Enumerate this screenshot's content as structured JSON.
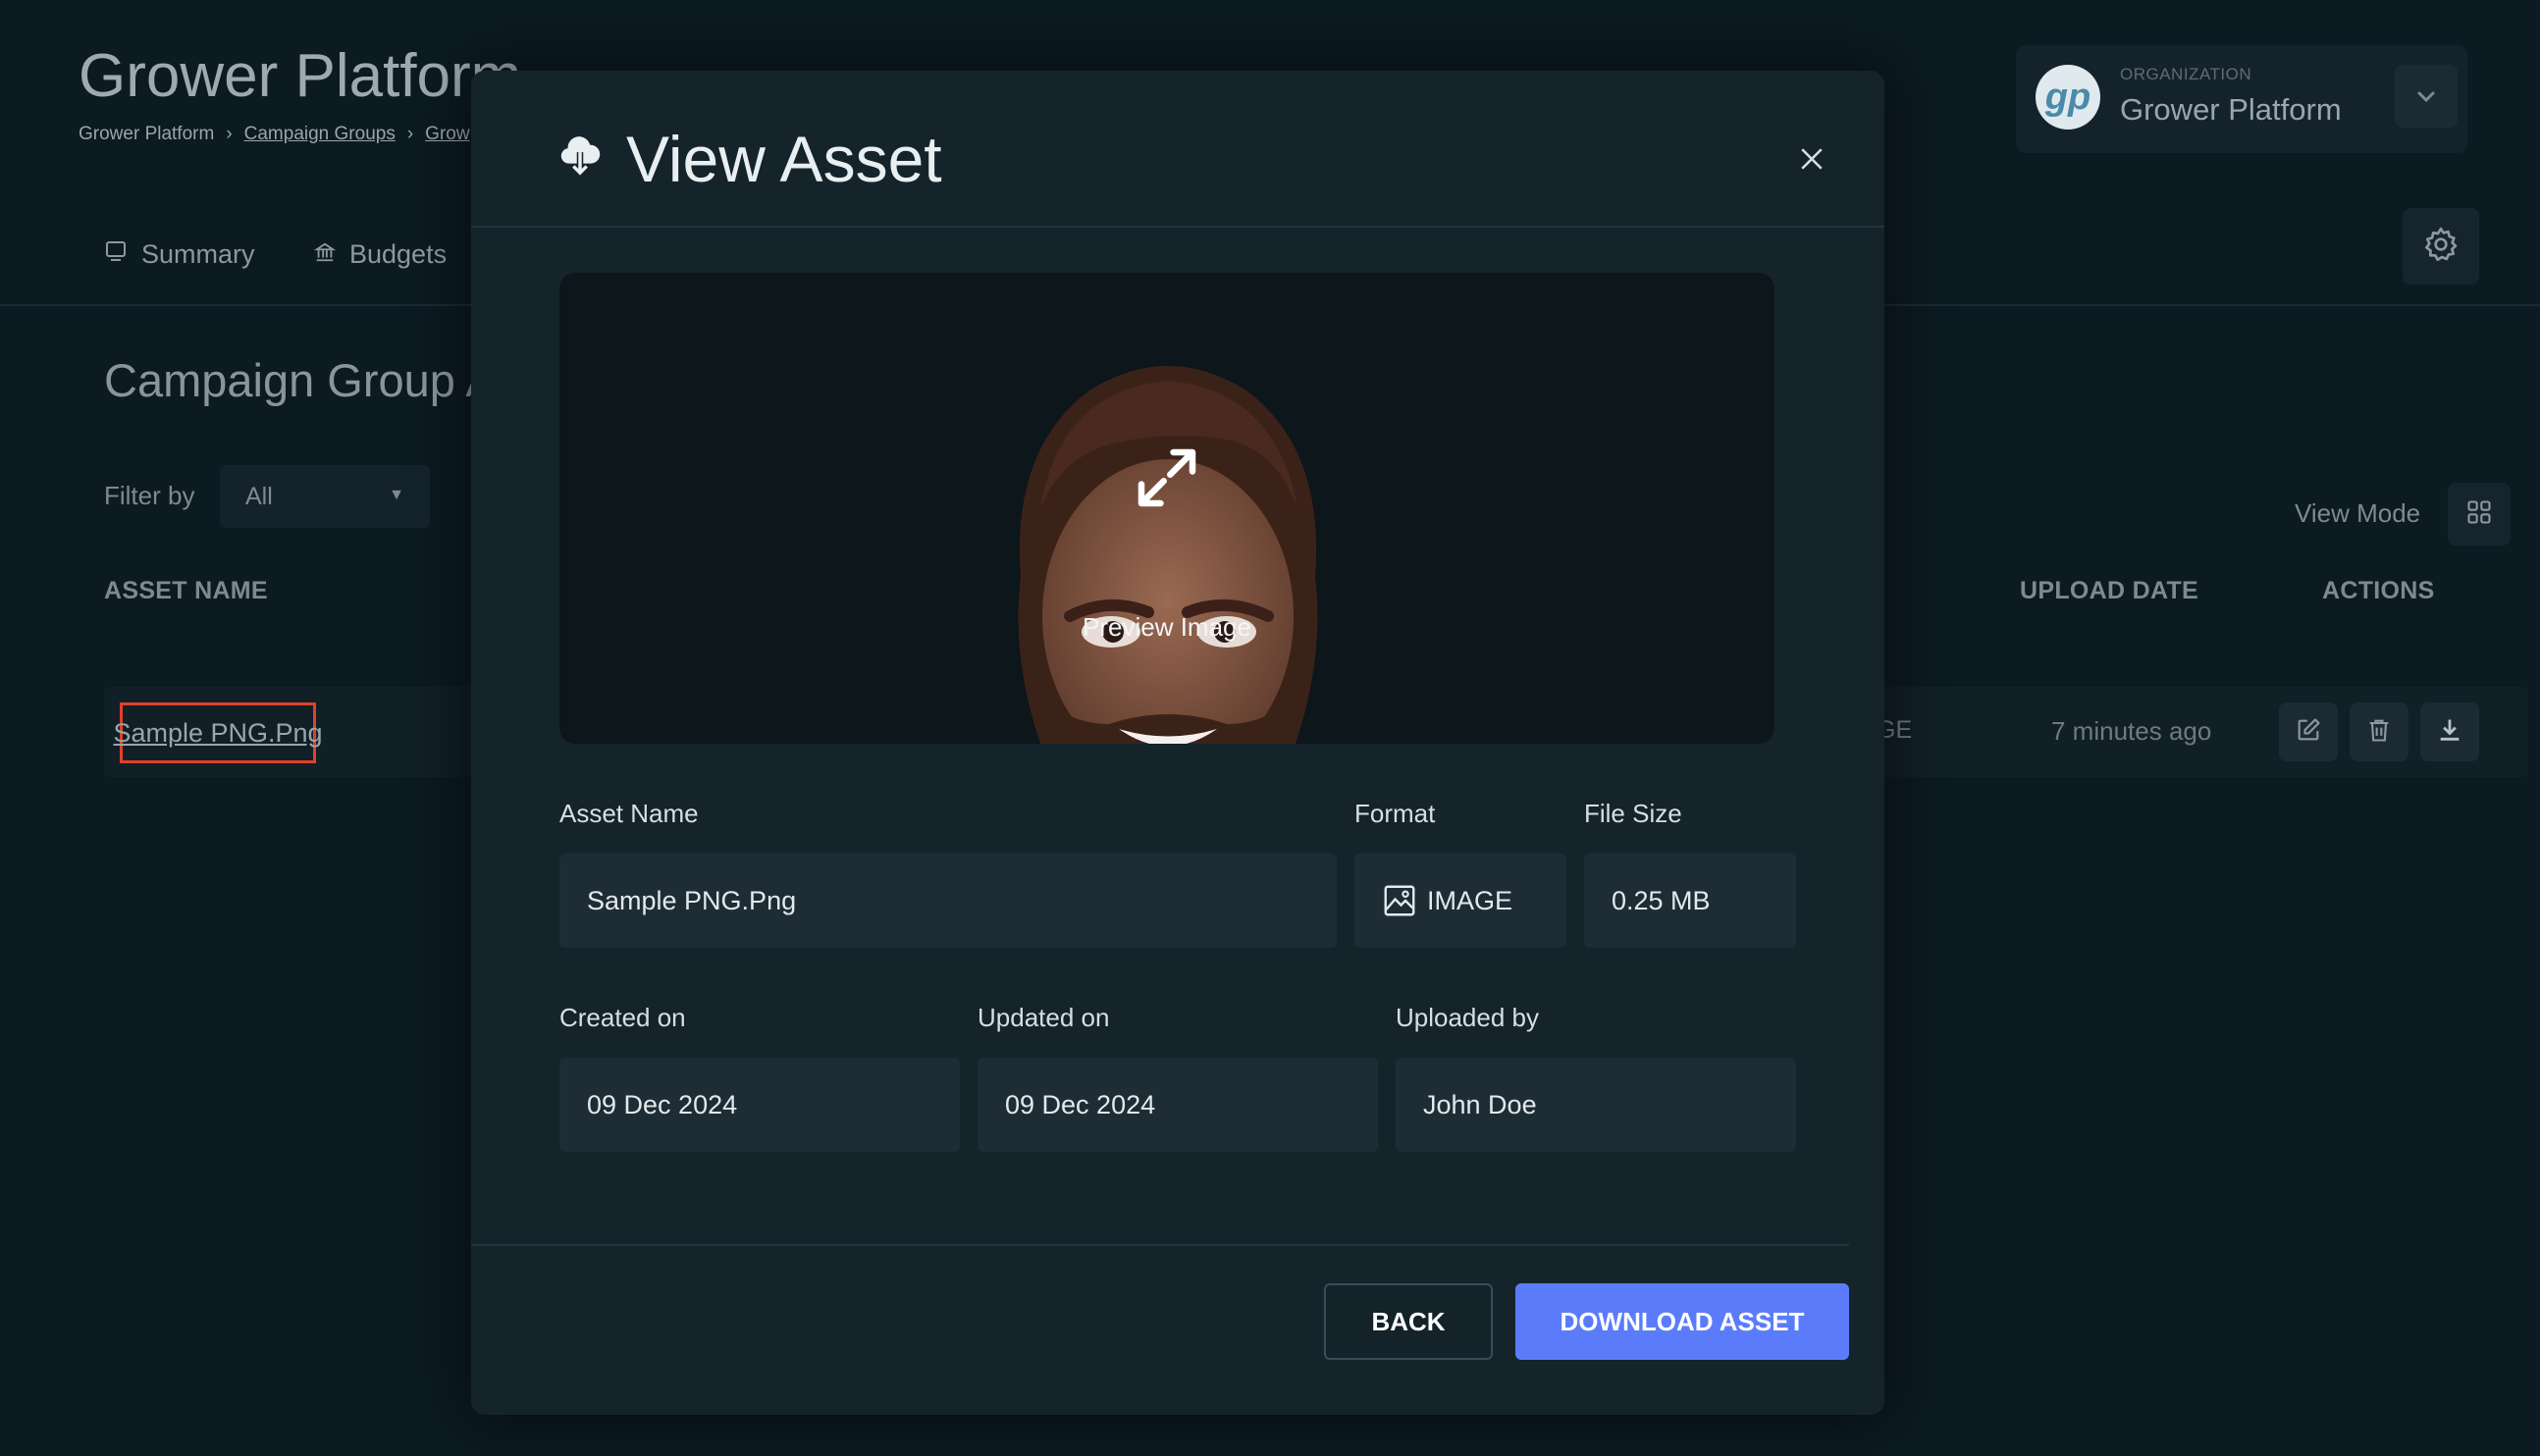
{
  "app": {
    "title": "Grower Platform"
  },
  "breadcrumb": {
    "items": [
      "Grower Platform",
      "Campaign Groups",
      "Grow"
    ],
    "separator": "›"
  },
  "organization": {
    "label": "ORGANIZATION",
    "name": "Grower Platform",
    "logo_text": "gp"
  },
  "tabs": [
    {
      "label": "Summary",
      "icon": "monitor-icon"
    },
    {
      "label": "Budgets",
      "icon": "bank-icon"
    }
  ],
  "section": {
    "title": "Campaign Group A"
  },
  "filter": {
    "label": "Filter by",
    "value": "All"
  },
  "view_mode": {
    "label": "View Mode",
    "icon": "grid-icon"
  },
  "table": {
    "headers": {
      "asset_name": "ASSET NAME",
      "upload_date": "UPLOAD DATE",
      "actions": "ACTIONS"
    },
    "rows": [
      {
        "asset_name": "Sample PNG.Png",
        "format_partial": "GE",
        "upload_date": "7 minutes ago"
      }
    ]
  },
  "modal": {
    "title": "View Asset",
    "preview_label": "Preview Image",
    "fields": {
      "asset_name": {
        "label": "Asset Name",
        "value": "Sample PNG.Png"
      },
      "format": {
        "label": "Format",
        "value": "IMAGE"
      },
      "file_size": {
        "label": "File Size",
        "value": "0.25 MB"
      },
      "created_on": {
        "label": "Created on",
        "value": "09 Dec 2024"
      },
      "updated_on": {
        "label": "Updated on",
        "value": "09 Dec 2024"
      },
      "uploaded_by": {
        "label": "Uploaded by",
        "value": "John Doe"
      }
    },
    "buttons": {
      "back": "BACK",
      "download": "DOWNLOAD ASSET"
    }
  },
  "colors": {
    "accent": "#5b7cfa",
    "highlight": "#e0412b",
    "modal_bg": "#15242b",
    "page_bg": "#0c1a22"
  }
}
